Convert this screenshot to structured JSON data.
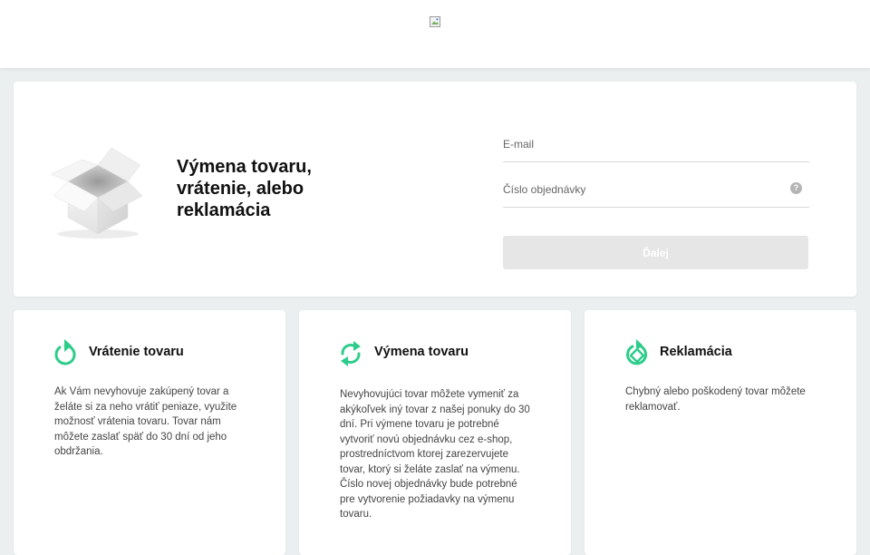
{
  "header": {
    "logo_icon": "broken-image-icon"
  },
  "hero": {
    "illustration_icon": "open-box-icon",
    "title_line1": "Výmena tovaru,",
    "title_line2": "vrátenie, alebo",
    "title_line3": "reklamácia",
    "email_placeholder": "E-mail",
    "order_placeholder": "Číslo objednávky",
    "help_glyph": "?",
    "next_label": "Ďalej"
  },
  "cards": [
    {
      "icon": "return-arrow-icon",
      "title": "Vrátenie tovaru",
      "text": "Ak Vám nevyhovuje zakúpený tovar a želáte si za neho vrátiť peniaze, využite možnosť vrátenia tovaru. Tovar nám môžete zaslať späť do 30 dní od jeho obdržania."
    },
    {
      "icon": "exchange-arrows-icon",
      "title": "Výmena tovaru",
      "text": "Nevyhovujúci tovar môžete vymeniť za akýkoľvek iný tovar z našej ponuky do 30 dní. Pri výmene tovaru je potrebné vytvoriť novú objednávku cez e-shop, prostredníctvom ktorej zarezervujete tovar, ktorý si želáte zaslať na výmenu. Číslo novej objednávky bude potrebné pre vytvorenie požiadavky na výmenu tovaru."
    },
    {
      "icon": "complaint-diamond-icon",
      "title": "Reklamácia",
      "text": "Chybný alebo poškodený tovar môžete reklamovať."
    }
  ],
  "colors": {
    "accent": "#2ecc8a",
    "background": "#eceff0",
    "button_disabled": "#e6e6e6"
  }
}
